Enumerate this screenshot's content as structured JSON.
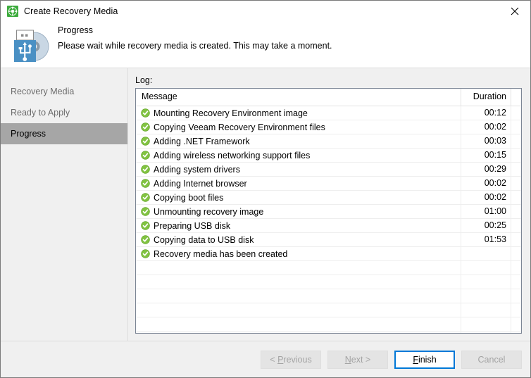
{
  "window": {
    "title": "Create Recovery Media",
    "title_icon": "recovery-media-icon",
    "close_label": "Close"
  },
  "header": {
    "icon": "usb-disc-icon",
    "title": "Progress",
    "subtitle": "Please wait while recovery media is created. This may take a moment."
  },
  "sidebar": {
    "items": [
      {
        "label": "Recovery Media",
        "active": false
      },
      {
        "label": "Ready to Apply",
        "active": false
      },
      {
        "label": "Progress",
        "active": true
      }
    ]
  },
  "log": {
    "label": "Log:",
    "columns": [
      "Message",
      "Duration"
    ],
    "status_icon": "success-check-icon",
    "rows": [
      {
        "message": "Mounting Recovery Environment image",
        "duration": "00:12",
        "status": "success"
      },
      {
        "message": "Copying Veeam Recovery Environment files",
        "duration": "00:02",
        "status": "success"
      },
      {
        "message": "Adding .NET Framework",
        "duration": "00:03",
        "status": "success"
      },
      {
        "message": "Adding wireless networking support files",
        "duration": "00:15",
        "status": "success"
      },
      {
        "message": "Adding system drivers",
        "duration": "00:29",
        "status": "success"
      },
      {
        "message": "Adding Internet browser",
        "duration": "00:02",
        "status": "success"
      },
      {
        "message": "Copying boot files",
        "duration": "00:02",
        "status": "success"
      },
      {
        "message": "Unmounting recovery image",
        "duration": "01:00",
        "status": "success"
      },
      {
        "message": "Preparing USB disk",
        "duration": "00:25",
        "status": "success"
      },
      {
        "message": "Copying data to USB disk",
        "duration": "01:53",
        "status": "success"
      },
      {
        "message": "Recovery media has been created",
        "duration": "",
        "status": "success"
      }
    ],
    "empty_rows": 6
  },
  "footer": {
    "buttons": [
      {
        "label": "< Previous",
        "enabled": false,
        "accel": "P"
      },
      {
        "label": "Next >",
        "enabled": false,
        "accel": "N"
      },
      {
        "label": "Finish",
        "enabled": true,
        "accel": "F"
      },
      {
        "label": "Cancel",
        "enabled": false,
        "accel": ""
      }
    ]
  },
  "colors": {
    "accent": "#0078d7",
    "success": "#78c043",
    "sidebar_active": "#a6a6a6",
    "panel": "#f0f0f0"
  }
}
